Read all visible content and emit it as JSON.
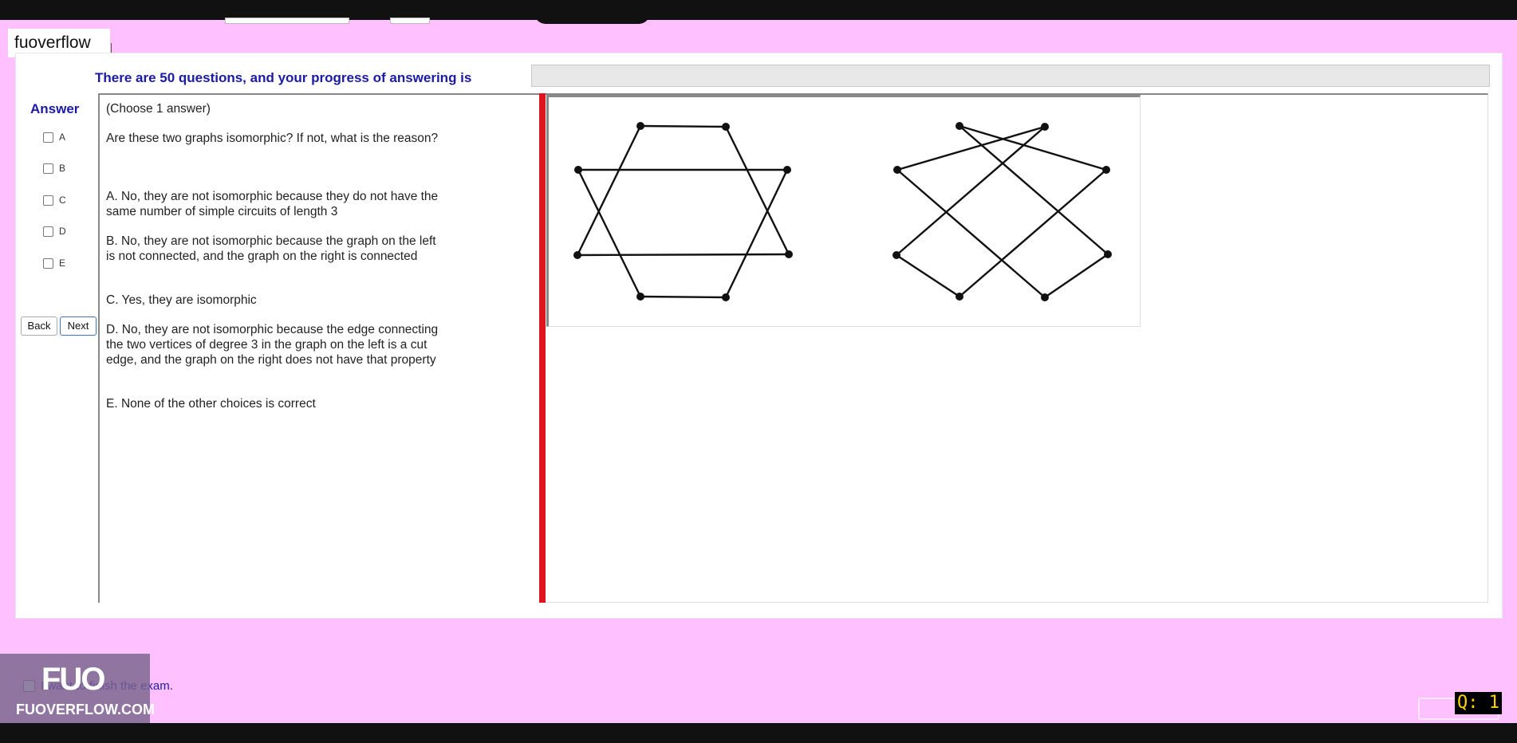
{
  "brand": "fuoverflow",
  "progress": {
    "label": "There are 50 questions, and your progress of answering is",
    "fraction": 0
  },
  "answer": {
    "title": "Answer",
    "options": [
      "A",
      "B",
      "C",
      "D",
      "E"
    ],
    "back_label": "Back",
    "next_label": "Next"
  },
  "question": {
    "instruction": "(Choose 1 answer)",
    "prompt": "Are these two graphs isomorphic? If not, what is the reason?",
    "choices": [
      "A.  No, they are not isomorphic because they do not have the same number of simple circuits of length 3",
      "B.  No, they are not isomorphic because the graph on the left is not connected, and the graph on the right is connected",
      "C.  Yes, they are isomorphic",
      "D.  No, they are not isomorphic because the edge connecting the two vertices of degree 3 in the graph on the left is a cut edge, and the graph on the right does not have that property",
      "E.  None of the other choices is correct"
    ]
  },
  "footer": {
    "finish_label": "I want to finish the exam.",
    "logo_mark": "FUO",
    "logo_text": "FUOVERFLOW.COM",
    "question_counter": "Q: 1"
  },
  "colors": {
    "background": "#ffc0ff",
    "accent": "#1a1aa6",
    "divider": "#e0141f"
  }
}
